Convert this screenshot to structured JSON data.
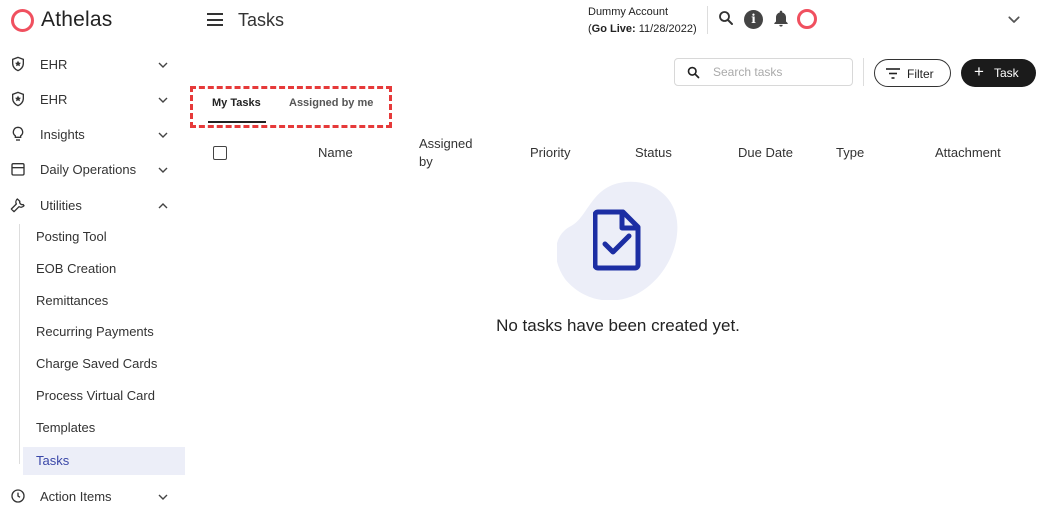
{
  "app": {
    "logo_text": "Athelas",
    "brand_color": "#f0505f"
  },
  "header": {
    "title": "Tasks",
    "account_name": "Dummy Account",
    "go_live_label": "Go Live:",
    "go_live_date": "11/28/2022",
    "icons": [
      "menu-icon",
      "search-icon",
      "info-icon",
      "bell-icon",
      "profile-ring-icon",
      "chevron-down-icon"
    ]
  },
  "sidebar": {
    "items": [
      {
        "label": "EHR",
        "icon": "shield-icon",
        "expanded": false
      },
      {
        "label": "EHR",
        "icon": "shield-icon",
        "expanded": false
      },
      {
        "label": "Insights",
        "icon": "lightbulb-icon",
        "expanded": false
      },
      {
        "label": "Daily Operations",
        "icon": "calendar-icon",
        "expanded": false
      },
      {
        "label": "Utilities",
        "icon": "wrench-icon",
        "expanded": true
      },
      {
        "label": "Action Items",
        "icon": "clock-icon",
        "expanded": false
      }
    ],
    "utilities_sub": [
      {
        "label": "Posting Tool"
      },
      {
        "label": "EOB Creation"
      },
      {
        "label": "Remittances"
      },
      {
        "label": "Recurring Payments"
      },
      {
        "label": "Charge Saved Cards"
      },
      {
        "label": "Process Virtual Card"
      },
      {
        "label": "Templates"
      },
      {
        "label": "Tasks",
        "active": true
      }
    ],
    "active_color": "#3a47a8"
  },
  "toolbar": {
    "search_placeholder": "Search tasks",
    "filter_label": "Filter",
    "add_task_label": "Task"
  },
  "tabs": [
    {
      "label": "My Tasks",
      "active": true
    },
    {
      "label": "Assigned by me",
      "active": false
    }
  ],
  "table": {
    "columns": [
      "Name",
      "Assigned by",
      "Priority",
      "Status",
      "Due Date",
      "Type",
      "Attachment"
    ],
    "rows": []
  },
  "empty_state": {
    "message": "No tasks have been created yet.",
    "icon": "document-check-icon",
    "icon_color": "#1c2ea3",
    "blob_color": "#eceef8"
  },
  "highlight_color": "#e63a3a"
}
